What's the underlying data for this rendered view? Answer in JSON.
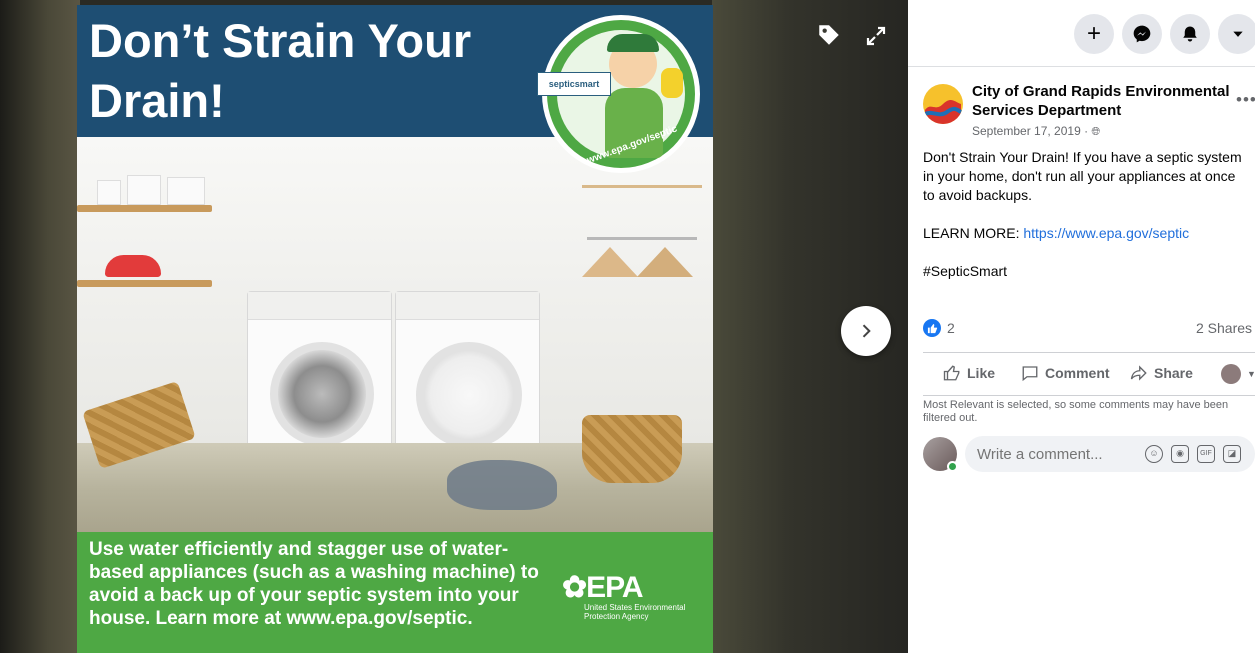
{
  "image": {
    "headline": "Don’t Strain Your Drain!",
    "badge_brand": "septicsmart",
    "badge_url": "www.epa.gov/septic",
    "bottom_text": "Use water efficiently and stagger use of water-based appliances (such as a washing machine) to avoid a back up of your septic system into your house. Learn more at www.epa.gov/septic.",
    "epa_logo": "EPA",
    "epa_sub": "United States Environmental Protection Agency"
  },
  "viewer_icons": {
    "tag": "tag-icon",
    "expand": "expand-icon",
    "next": "chevron-right-icon"
  },
  "post": {
    "page_name": "City of Grand Rapids Environmental Services Department",
    "date": "September 17, 2019 ·",
    "text_line1": "Don't Strain Your Drain! If you have a septic system in your home, don't run all your appliances at once to avoid backups.",
    "learn_more_label": "LEARN MORE: ",
    "learn_more_link": "https://www.epa.gov/septic",
    "hashtag": "#SepticSmart",
    "reaction_count": "2",
    "share_count": "2 Shares"
  },
  "actions": {
    "like": "Like",
    "comment": "Comment",
    "share": "Share"
  },
  "filter_note": "Most Relevant is selected, so some comments may have been filtered out.",
  "comment": {
    "placeholder": "Write a comment..."
  },
  "colors": {
    "facebook_blue": "#1877f2",
    "epa_green": "#4ea844",
    "headline_blue": "#1e4e73"
  }
}
